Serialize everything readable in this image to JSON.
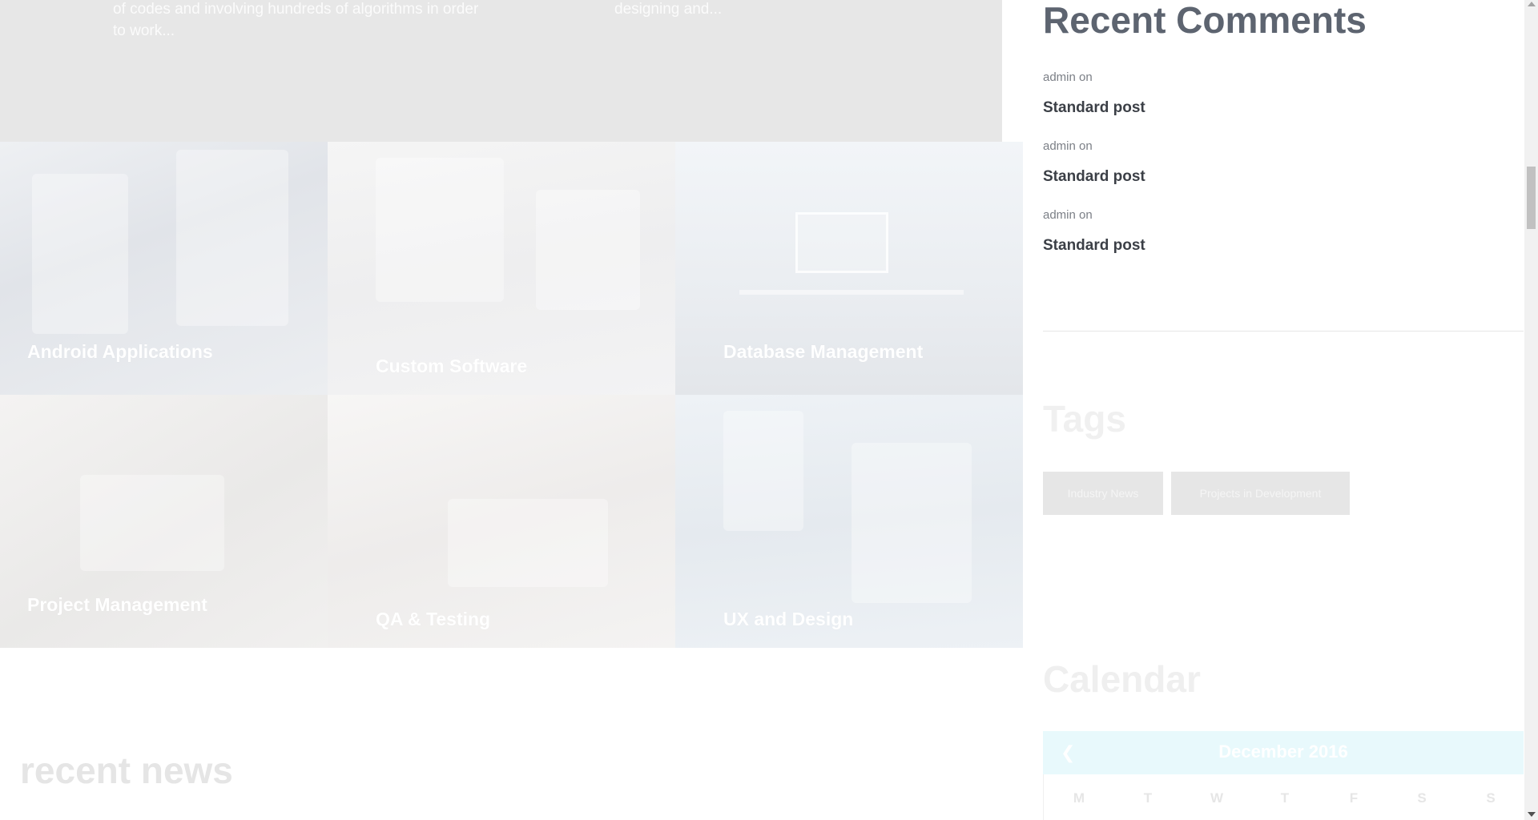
{
  "excerpts": [
    "of codes and involving hundreds of algorithms in order to work...",
    "designing and..."
  ],
  "services": [
    {
      "label": "Android Applications"
    },
    {
      "label": "Custom Software"
    },
    {
      "label": "Database Management"
    },
    {
      "label": "Project Management"
    },
    {
      "label": "QA & Testing"
    },
    {
      "label": "UX and Design"
    }
  ],
  "recent_news": {
    "title": "recent news"
  },
  "sidebar": {
    "recent_comments": {
      "title": "Recent Comments",
      "items": [
        {
          "meta": "admin on",
          "link": "Standard post"
        },
        {
          "meta": "admin on",
          "link": "Standard post"
        },
        {
          "meta": "admin on",
          "link": "Standard post"
        }
      ]
    },
    "tags": {
      "title": "Tags",
      "items": [
        "Industry News",
        "Projects in Development"
      ]
    },
    "calendar": {
      "title": "Calendar",
      "month": "December 2016",
      "prev_icon": "chevron-left-icon",
      "weekdays": [
        "M",
        "T",
        "W",
        "T",
        "F",
        "S",
        "S"
      ]
    }
  }
}
